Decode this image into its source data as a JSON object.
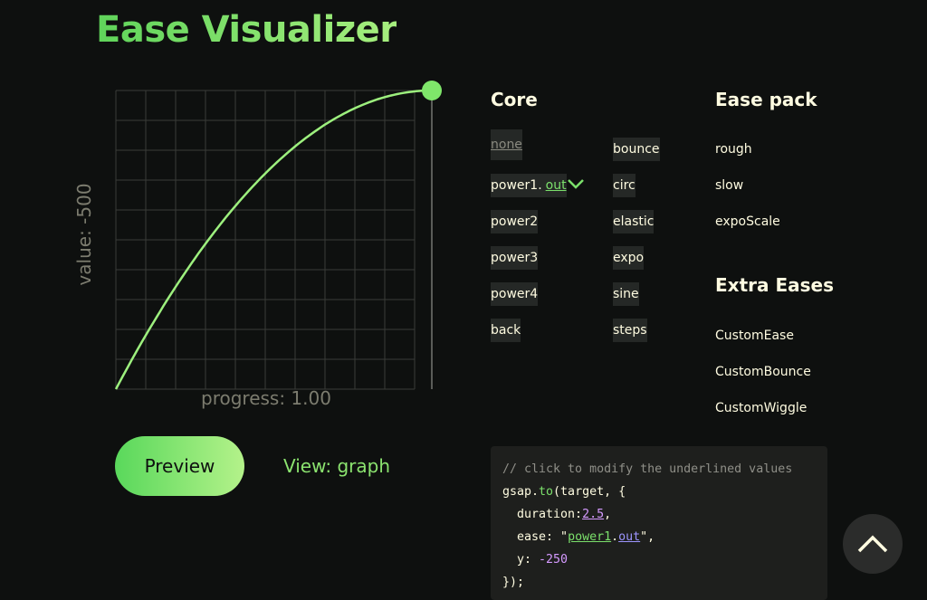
{
  "page": {
    "title": "Ease Visualizer"
  },
  "graph": {
    "y_axis_label": "value: -500",
    "x_axis_label": "progress: 1.00",
    "progress": 1.0,
    "curve_color": "#9df07e",
    "grid_color": "#3a3c39"
  },
  "controls": {
    "preview_label": "Preview",
    "view_label": "View: graph"
  },
  "core": {
    "heading": "Core",
    "col1": [
      "none",
      "power1",
      "power2",
      "power3",
      "power4",
      "back"
    ],
    "col2": [
      "bounce",
      "circ",
      "elastic",
      "expo",
      "sine",
      "steps"
    ],
    "power1_dot": ".",
    "power1_suffix": "out"
  },
  "ease_pack": {
    "heading": "Ease pack",
    "items": [
      "rough",
      "slow",
      "expoScale"
    ]
  },
  "extra_eases": {
    "heading": "Extra Eases",
    "items": [
      "CustomEase",
      "CustomBounce",
      "CustomWiggle"
    ]
  },
  "code": {
    "comment": "// click to modify the underlined values",
    "l2_prefix": "gsap.",
    "l2_method": "to",
    "l2_suffix": "(target, {",
    "duration_key": "  duration:",
    "duration_value": "2.5",
    "duration_comma": ",",
    "ease_key": "  ease: \"",
    "ease_name": "power1",
    "ease_dot": ".",
    "ease_type": "out",
    "ease_close": "\",",
    "y_key": "  y: ",
    "y_value": "-250",
    "close": "});"
  },
  "icons": {
    "scroll_top": "chevron-up-icon",
    "expand": "chevron-down-icon"
  },
  "colors": {
    "accent": "#7be06b",
    "background": "#0e100f",
    "text": "#fffce1"
  }
}
